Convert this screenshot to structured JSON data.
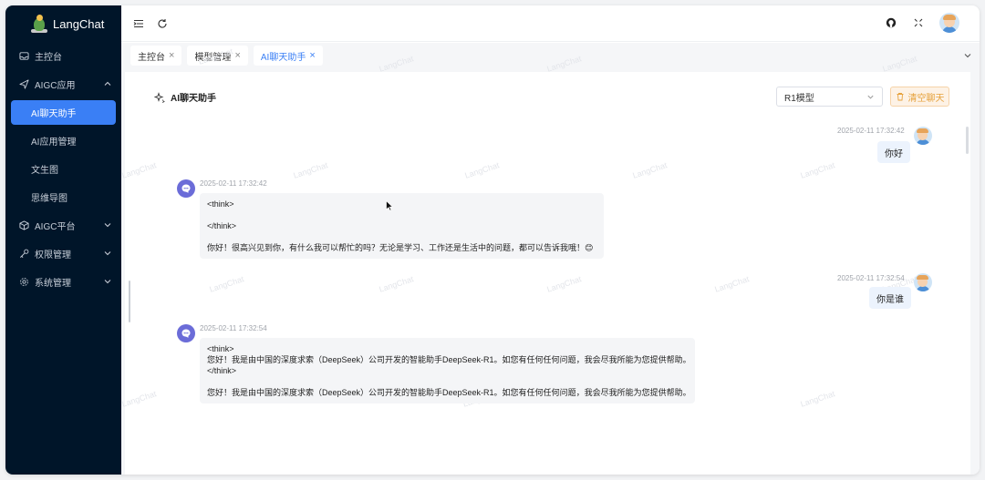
{
  "app": {
    "name": "LangChat",
    "watermark": "LangChat"
  },
  "sidebar": {
    "items": [
      {
        "label": "主控台",
        "icon": "inbox-icon"
      },
      {
        "label": "AIGC应用",
        "icon": "send-icon",
        "expanded": true
      },
      {
        "label": "AI聊天助手",
        "active": true
      },
      {
        "label": "AI应用管理"
      },
      {
        "label": "文生图"
      },
      {
        "label": "思维导图"
      },
      {
        "label": "AIGC平台",
        "icon": "cube-icon"
      },
      {
        "label": "权限管理",
        "icon": "key-icon"
      },
      {
        "label": "系统管理",
        "icon": "gear-icon"
      }
    ]
  },
  "tabs": [
    {
      "label": "主控台"
    },
    {
      "label": "模型管理"
    },
    {
      "label": "AI聊天助手",
      "active": true
    }
  ],
  "chat": {
    "title": "AI聊天助手",
    "model_selected": "R1模型",
    "clear_label": "清空聊天",
    "messages": [
      {
        "role": "user",
        "time": "2025-02-11 17:32:42",
        "text": "你好"
      },
      {
        "role": "bot",
        "time": "2025-02-11 17:32:42",
        "line1": "<think>",
        "line2": "</think>",
        "line3": "你好！很高兴见到你，有什么我可以帮忙的吗？无论是学习、工作还是生活中的问题，都可以告诉我哦！😊"
      },
      {
        "role": "user",
        "time": "2025-02-11 17:32:54",
        "text": "你是谁"
      },
      {
        "role": "bot",
        "time": "2025-02-11 17:32:54",
        "line1": "<think>",
        "line2": "您好！我是由中国的深度求索（DeepSeek）公司开发的智能助手DeepSeek-R1。如您有任何任何问题，我会尽我所能为您提供帮助。",
        "line3": "</think>",
        "line4": "您好！我是由中国的深度求索（DeepSeek）公司开发的智能助手DeepSeek-R1。如您有任何任何问题，我会尽我所能为您提供帮助。"
      }
    ]
  },
  "colors": {
    "sidebar_bg": "#001529",
    "accent": "#3a7ff5",
    "warning": "#e6a23c",
    "bot_avatar": "#6b6cd8"
  }
}
